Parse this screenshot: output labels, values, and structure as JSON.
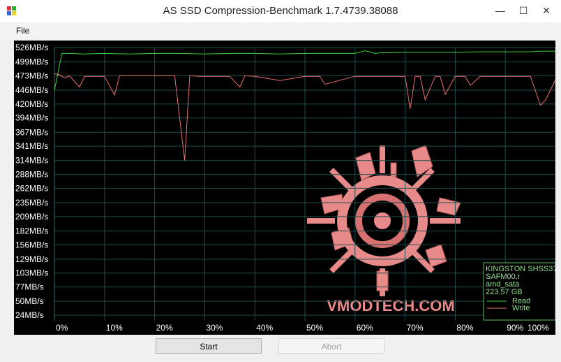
{
  "window": {
    "title": "AS SSD Compression-Benchmark 1.7.4739.38088",
    "minimize_glyph": "—",
    "maximize_glyph": "☐",
    "close_glyph": "✕"
  },
  "menu": {
    "file_label": "File"
  },
  "buttons": {
    "start_label": "Start",
    "abort_label": "Abort",
    "abort_enabled": false
  },
  "legend": {
    "device_lines": [
      "KINGSTON SHSS37",
      "SAFM00.r",
      "amd_sata",
      "223.57 GB"
    ],
    "read_label": "Read",
    "write_label": "Write"
  },
  "watermark": {
    "text": "VMODTECH.COM",
    "color": "#f08a8a"
  },
  "colors": {
    "read": "#3cd43c",
    "write": "#e87070",
    "grid": "#1e4e4e",
    "axis_text": "#ffffff",
    "legend_text": "#8fdf8f",
    "background": "#000000"
  },
  "chart_data": {
    "type": "line",
    "title": "",
    "xlabel": "",
    "ylabel": "",
    "x_ticks": [
      "0%",
      "10%",
      "20%",
      "30%",
      "40%",
      "50%",
      "60%",
      "70%",
      "80%",
      "90%",
      "100%"
    ],
    "y_ticks": [
      "526MB/s",
      "499MB/s",
      "473MB/s",
      "446MB/s",
      "420MB/s",
      "394MB/s",
      "367MB/s",
      "341MB/s",
      "314MB/s",
      "288MB/s",
      "262MB/s",
      "235MB/s",
      "209MB/s",
      "182MB/s",
      "156MB/s",
      "129MB/s",
      "103MB/s",
      "77MB/s",
      "50MB/s",
      "24MB/s"
    ],
    "xlim": [
      0,
      100
    ],
    "ylim": [
      24,
      526
    ],
    "grid": true,
    "legend_position": "bottom-right",
    "series": [
      {
        "name": "Read",
        "x": [
          0,
          1.5,
          3,
          6,
          10,
          15,
          20,
          25,
          30,
          35,
          40,
          45,
          50,
          55,
          60,
          62,
          64,
          65,
          70,
          75,
          80,
          85,
          90,
          95,
          97,
          100
        ],
        "y": [
          446,
          515,
          515,
          514,
          515,
          514,
          515,
          515,
          514,
          515,
          515,
          514,
          515,
          515,
          515,
          520,
          515,
          516,
          517,
          517,
          517,
          518,
          518,
          518,
          519,
          519
        ]
      },
      {
        "name": "Write",
        "x": [
          0,
          1,
          2,
          3,
          5,
          6,
          10,
          12,
          13,
          15,
          20,
          24,
          26,
          27,
          29,
          35,
          37,
          38,
          40,
          45,
          50,
          53,
          54,
          60,
          70,
          71,
          72,
          73,
          74,
          76,
          77,
          78,
          80,
          82,
          83,
          85,
          90,
          95,
          97,
          98,
          100
        ],
        "y": [
          477,
          475,
          469,
          473,
          452,
          472,
          472,
          437,
          473,
          473,
          473,
          473,
          314,
          473,
          472,
          472,
          452,
          473,
          472,
          464,
          472,
          472,
          457,
          472,
          472,
          411,
          472,
          472,
          428,
          472,
          472,
          438,
          472,
          472,
          455,
          472,
          472,
          472,
          418,
          427,
          465
        ]
      }
    ]
  }
}
